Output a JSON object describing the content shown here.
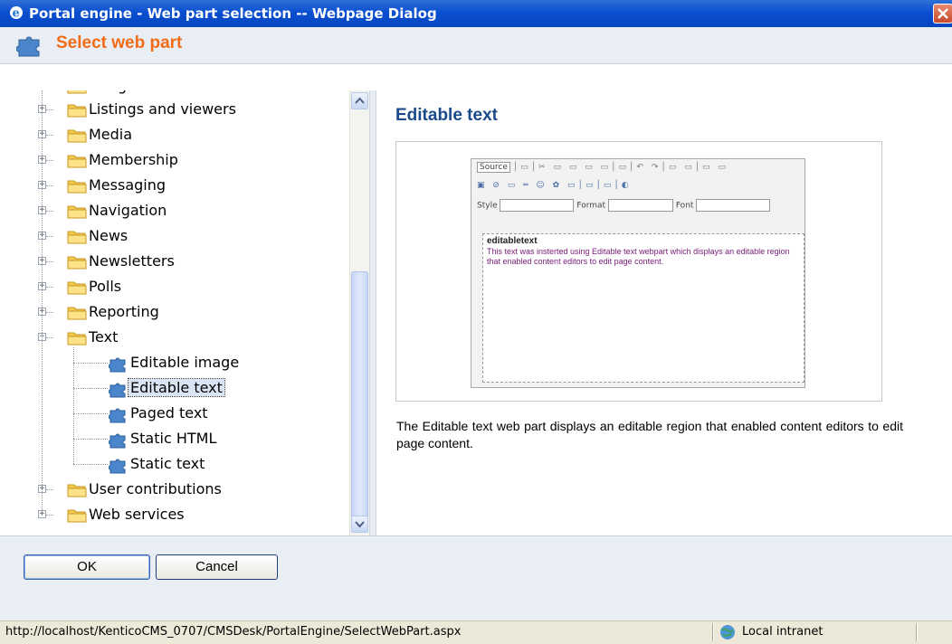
{
  "window": {
    "title": "Portal engine - Web part selection -- Webpage Dialog",
    "close_glyph": "✕"
  },
  "header": {
    "title": "Select web part",
    "icon": "puzzle-icon"
  },
  "tree": {
    "partial_top_label": "Google services",
    "categories": [
      {
        "label": "Listings and viewers",
        "expander": "+"
      },
      {
        "label": "Media",
        "expander": "+"
      },
      {
        "label": "Membership",
        "expander": "+"
      },
      {
        "label": "Messaging",
        "expander": "+"
      },
      {
        "label": "Navigation",
        "expander": "+"
      },
      {
        "label": "News",
        "expander": "+"
      },
      {
        "label": "Newsletters",
        "expander": "+"
      },
      {
        "label": "Polls",
        "expander": "+"
      },
      {
        "label": "Reporting",
        "expander": "+"
      },
      {
        "label": "Text",
        "expander": "−"
      }
    ],
    "text_children": [
      {
        "label": "Editable image"
      },
      {
        "label": "Editable text",
        "selected": true
      },
      {
        "label": "Paged text"
      },
      {
        "label": "Static HTML"
      },
      {
        "label": "Static text"
      }
    ],
    "trailing_categories": [
      {
        "label": "User contributions",
        "expander": "+"
      },
      {
        "label": "Web services",
        "expander": "+"
      }
    ]
  },
  "detail": {
    "title": "Editable text",
    "description": "The Editable text web part displays an editable region that enabled content editors to edit page content.",
    "preview": {
      "toolbar_row1": "Source",
      "style_label": "Style",
      "format_label": "Format",
      "font_label": "Font",
      "content_title": "editabletext",
      "content_text": "This text was insterted using Editable text webpart which displays an editable region that enabled content editors to edit page content."
    }
  },
  "buttons": {
    "ok": "OK",
    "cancel": "Cancel"
  },
  "statusbar": {
    "url": "http://localhost/KenticoCMS_0707/CMSDesk/PortalEngine/SelectWebPart.aspx",
    "zone": "Local intranet"
  },
  "colors": {
    "header_title": "#f26b16",
    "detail_title": "#1b4a8a",
    "titlebar": "#0a4fd0"
  }
}
